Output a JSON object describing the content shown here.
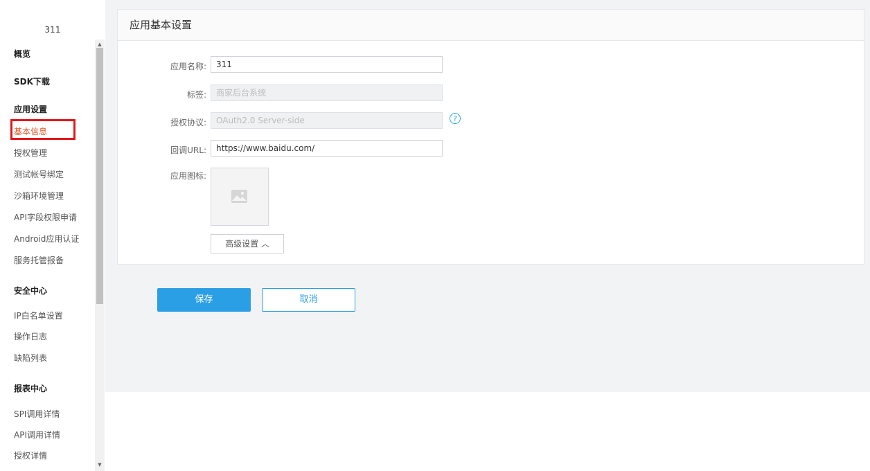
{
  "sidebar": {
    "app_id": "311",
    "sections": [
      {
        "label": "概览",
        "items": []
      },
      {
        "label": "SDK下载",
        "items": []
      },
      {
        "label": "应用设置",
        "items": [
          "基本信息",
          "授权管理",
          "测试帐号绑定",
          "沙箱环境管理",
          "API字段权限申请",
          "Android应用认证",
          "服务托管报备"
        ]
      },
      {
        "label": "安全中心",
        "items": [
          "IP白名单设置",
          "操作日志",
          "缺陷列表"
        ]
      },
      {
        "label": "报表中心",
        "items": [
          "SPI调用详情",
          "API调用详情",
          "授权详情"
        ]
      }
    ],
    "active_item": "基本信息"
  },
  "panel": {
    "title": "应用基本设置",
    "fields": {
      "name_label": "应用名称:",
      "name_value": "311",
      "tag_label": "标签:",
      "tag_placeholder": "商家后台系统",
      "auth_label": "授权协议:",
      "auth_placeholder": "OAuth2.0 Server-side",
      "callback_label": "回调URL:",
      "callback_value": "https://www.baidu.com/",
      "icon_label": "应用图标:"
    },
    "advanced_label": "高级设置 ︿"
  },
  "actions": {
    "save_label": "保存",
    "cancel_label": "取消"
  },
  "colors": {
    "accent": "#2b9fe6",
    "active_nav": "#e05b2c",
    "highlight_box": "#e0171b"
  }
}
